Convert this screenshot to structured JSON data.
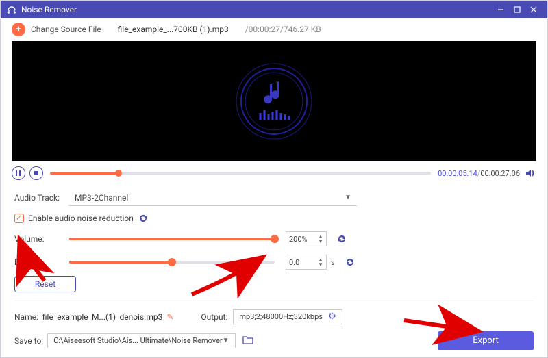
{
  "titlebar": {
    "title": "Noise Remover"
  },
  "toprow": {
    "change_label": "Change Source File",
    "filename": "file_example_...700KB (1).mp3",
    "meta": "/00:00:27/746.27 KB"
  },
  "playback": {
    "current": "00:00:05.14",
    "sep": "/",
    "total": "00:00:27.06",
    "progress_pct": 18
  },
  "track": {
    "label": "Audio Track:",
    "selected": "MP3-2Channel"
  },
  "noise": {
    "label": "Enable audio noise reduction"
  },
  "volume": {
    "label": "Volume:",
    "value": "200%",
    "pct": 100
  },
  "delay": {
    "label": "Delay:",
    "value": "0.0",
    "unit": "s",
    "pct": 50
  },
  "reset": {
    "label": "Reset"
  },
  "output": {
    "name_label": "Name:",
    "name_value": "file_example_M...(1)_denois.mp3",
    "out_label": "Output:",
    "out_value": "mp3;2;48000Hz;320kbps"
  },
  "save": {
    "label": "Save to:",
    "path": "C:\\Aiseesoft Studio\\Ais... Ultimate\\Noise Remover"
  },
  "export": {
    "label": "Export"
  }
}
